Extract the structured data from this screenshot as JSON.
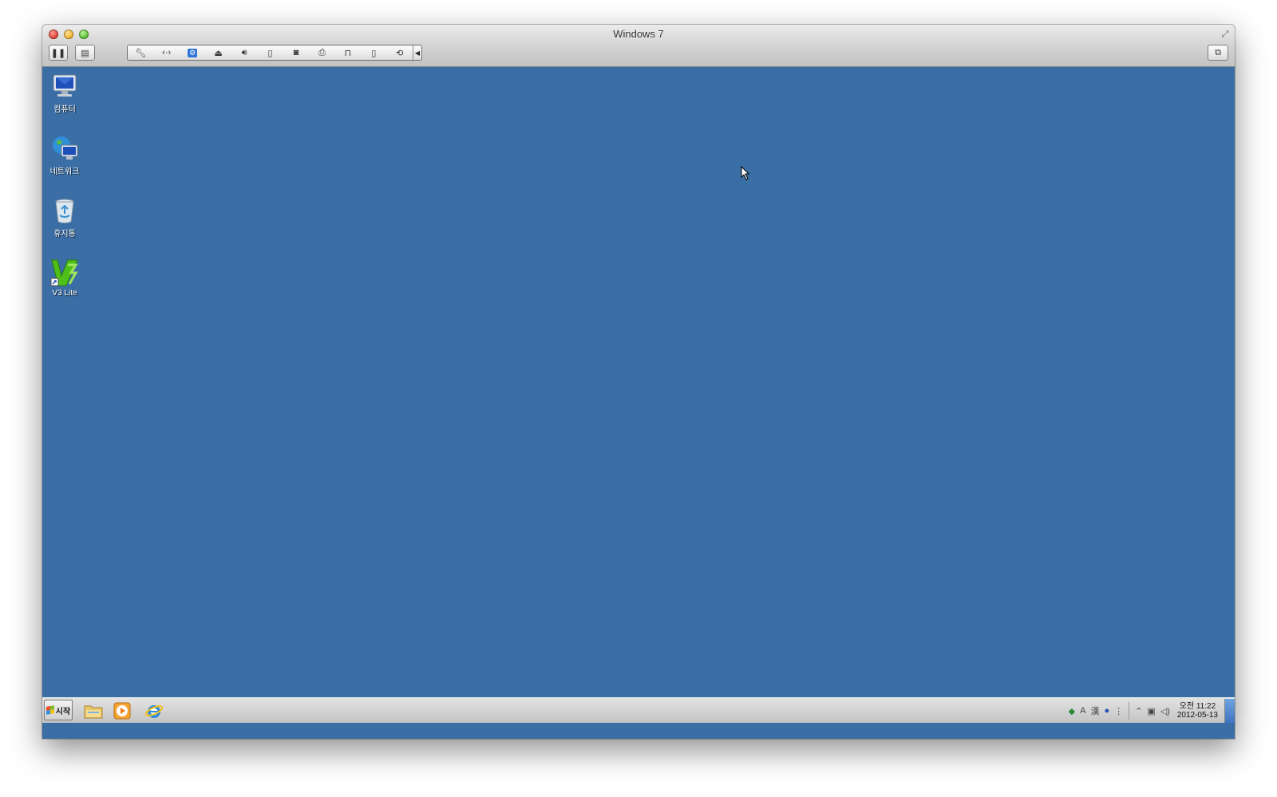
{
  "window": {
    "title": "Windows 7"
  },
  "toolbar": {
    "pause_icon": "pause-icon",
    "snapshot_icon": "snapshot-icon",
    "group_icons": [
      "wrench-icon",
      "network-icon",
      "usb-icon",
      "cd-icon",
      "sound-icon",
      "device-icon",
      "camera-icon",
      "printer-icon",
      "mouse-icon",
      "phone-icon",
      "sync-icon"
    ],
    "collapse_icon": "chevron-left-icon",
    "window_mode_icon": "window-mode-icon"
  },
  "desktop": {
    "background": "#3b6ea5",
    "icons": [
      {
        "label": "컴퓨터"
      },
      {
        "label": "네트워크"
      },
      {
        "label": "휴지통"
      },
      {
        "label": "V3 Lite"
      }
    ]
  },
  "taskbar": {
    "start_label": "시작",
    "pinned": [
      "explorer-icon",
      "media-player-icon",
      "internet-explorer-icon"
    ],
    "tray": {
      "lang_a": "A",
      "lang_han": "漢",
      "clock_time": "오전 11:22",
      "clock_date": "2012-05-13"
    }
  }
}
